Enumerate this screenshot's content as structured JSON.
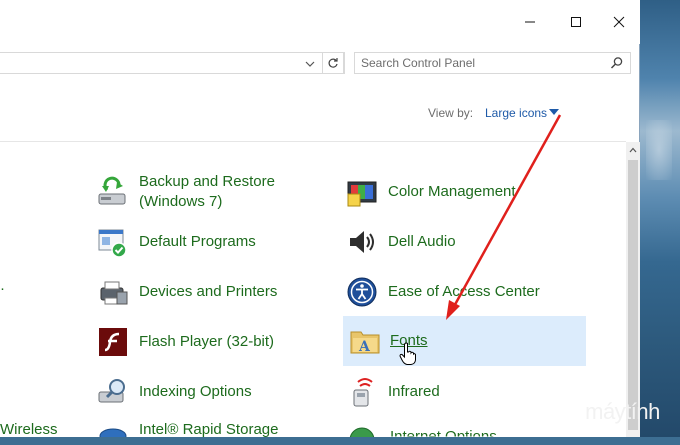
{
  "search": {
    "placeholder": "Search Control Panel"
  },
  "view": {
    "label": "View by:",
    "value": "Large icons"
  },
  "items_left_partial": [
    "Wireless"
  ],
  "items": [
    {
      "label": "Backup and Restore\n(Windows 7)",
      "line1": "Backup and Restore",
      "line2": "(Windows 7)",
      "icon": "backup-restore-icon"
    },
    {
      "label": "Color Management",
      "icon": "color-management-icon"
    },
    {
      "label": "Default Programs",
      "icon": "default-programs-icon"
    },
    {
      "label": "Dell Audio",
      "icon": "speaker-icon"
    },
    {
      "label": "Devices and Printers",
      "icon": "printer-icon"
    },
    {
      "label": "Ease of Access Center",
      "icon": "ease-of-access-icon"
    },
    {
      "label": "Flash Player (32-bit)",
      "icon": "flash-player-icon"
    },
    {
      "label": "Fonts",
      "icon": "fonts-folder-icon"
    },
    {
      "label": "Indexing Options",
      "icon": "indexing-options-icon"
    },
    {
      "label": "Infrared",
      "icon": "infrared-icon"
    },
    {
      "label": "Intel® Rapid Storage",
      "icon": "intel-storage-icon"
    }
  ],
  "watermark": {
    "part1": "biết",
    "part2": "máytính"
  },
  "colors": {
    "link": "#1d6b1d",
    "accent": "#1e5aa8",
    "highlight": "#dcecfc",
    "arrow": "#e0201c"
  }
}
